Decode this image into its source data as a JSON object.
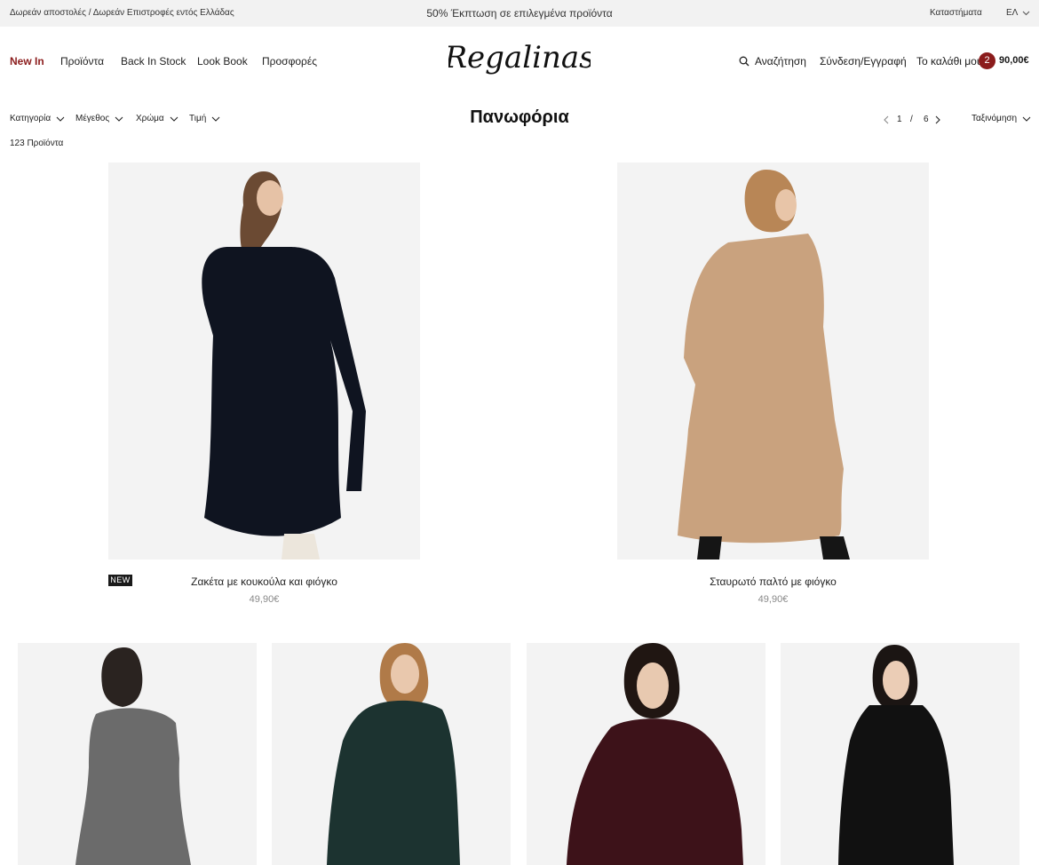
{
  "announcement": {
    "shipping": "Δωρεάν αποστολές / Δωρεάν Επιστροφές εντός Ελλάδας",
    "promo": "50% Έκπτωση σε επιλεγμένα προϊόντα",
    "stores": "Καταστήματα",
    "language": "ΕΛ"
  },
  "nav": {
    "new_in": "New In",
    "products": "Προϊόντα",
    "back_in_stock": "Back In Stock",
    "look_book": "Look Book",
    "offers": "Προσφορές"
  },
  "brand": {
    "logo_text": "Regalinas"
  },
  "account": {
    "search": "Αναζήτηση",
    "login": "Σύνδεση/Εγγραφή",
    "cart": "Το καλάθι μου",
    "cart_count": "2",
    "cart_total": "90,00€"
  },
  "filters": {
    "category": "Κατηγορία",
    "size": "Μέγεθος",
    "color": "Χρώμα",
    "price": "Τιμή"
  },
  "page": {
    "title": "Πανωφόρια",
    "product_count": "123 Προϊόντα",
    "current_page": "1",
    "separator": "/",
    "total_pages": "6",
    "sort": "Ταξινόμηση"
  },
  "products": [
    {
      "name": "Ζακέτα με κουκούλα και φιόγκο",
      "price": "49,90€",
      "badge": "NEW",
      "color": "#0f1420"
    },
    {
      "name": "Σταυρωτό παλτό με φιόγκο",
      "price": "49,90€",
      "color": "#c9a27e"
    },
    {
      "color": "#6b6b6b"
    },
    {
      "color": "#1c3330"
    },
    {
      "color": "#3d1219"
    },
    {
      "color": "#111111"
    }
  ],
  "colors": {
    "accent": "#8b1c1c",
    "image_bg": "#f3f3f3",
    "topbar_bg": "#f2f2f2"
  }
}
